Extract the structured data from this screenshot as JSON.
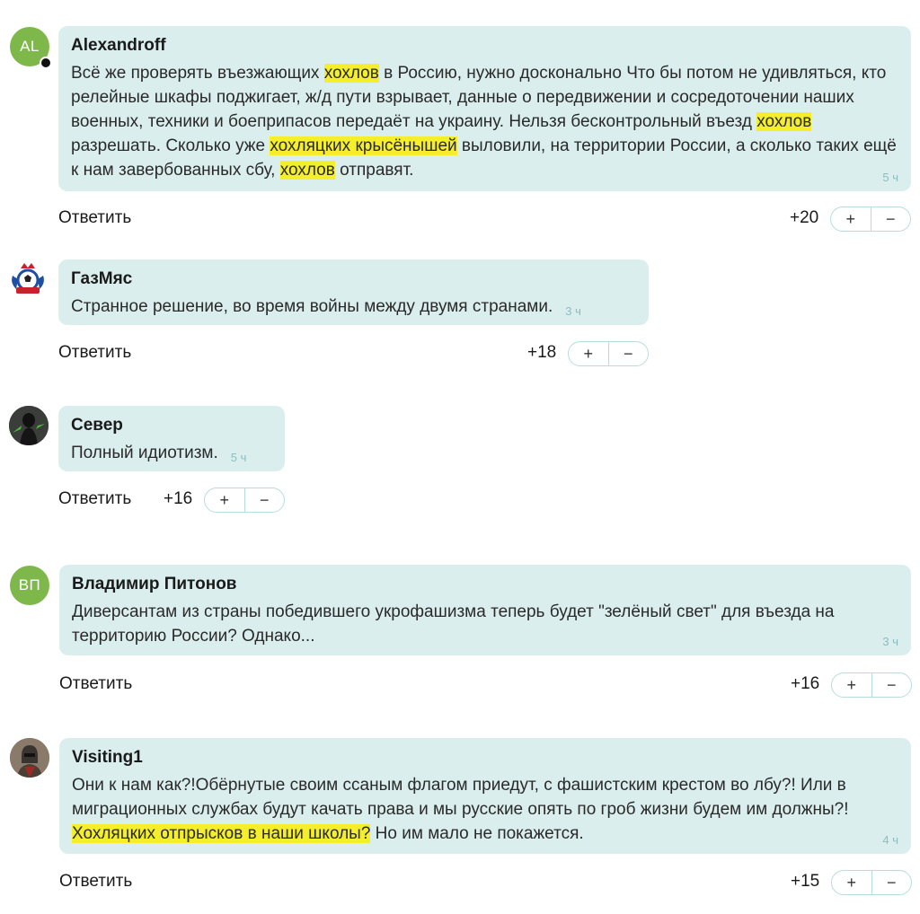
{
  "comments": [
    {
      "author": "Alexandroff",
      "avatar_initials": "AL",
      "text_parts": [
        "Всё же проверять въезжающих ",
        "хохлов",
        " в Россию, нужно досконально Что бы потом не удивляться, кто релейные шкафы поджигает, ж/д пути взрывает, данные о передвижении и сосредоточении наших военных, техники и боеприпасов передаёт на украину. Нельзя бесконтрольный въезд ",
        "хохлов",
        " разрешать. Сколько уже ",
        "хохляцких крысёнышей",
        " выловили, на территории России, а сколько таких ещё к нам завербованных сбу, ",
        "хохлов",
        " отправят."
      ],
      "time": "5 ч",
      "reply_label": "Ответить",
      "score": "+20",
      "vote_plus": "+",
      "vote_minus": "−"
    },
    {
      "author": "ГазМяс",
      "avatar_icon": "football-club-emblem-icon",
      "text": "Странное решение, во время войны между двумя странами.",
      "time": "3 ч",
      "reply_label": "Ответить",
      "score": "+18",
      "vote_plus": "+",
      "vote_minus": "−"
    },
    {
      "author": "Север",
      "avatar_icon": "dark-figure-photo-icon",
      "text": "Полный идиотизм.",
      "time": "5 ч",
      "reply_label": "Ответить",
      "score": "+16",
      "vote_plus": "+",
      "vote_minus": "−"
    },
    {
      "author": "Владимир Питонов",
      "avatar_initials": "ВП",
      "text": "Диверсантам из страны победившего укрофашизма теперь будет \"зелёный свет\" для въезда на территорию России? Однако...",
      "time": "3 ч",
      "reply_label": "Ответить",
      "score": "+16",
      "vote_plus": "+",
      "vote_minus": "−"
    },
    {
      "author": "Visiting1",
      "avatar_icon": "helmeted-warrior-photo-icon",
      "text_parts": [
        "Они к нам как?!Обёрнутые своим ссаным флагом приедут, с фашистским крестом во лбу?! Или в миграционных службах будут качать права и мы русские опять по гроб жизни будем им должны?!",
        "Хохляцких отпрысков в наши школы?",
        " Но им мало не покажется."
      ],
      "time": "4 ч",
      "reply_label": "Ответить",
      "score": "+15",
      "vote_plus": "+",
      "vote_minus": "−"
    }
  ],
  "colors": {
    "bubble": "#dbeeee",
    "highlight": "#f4ef2a",
    "initials_avatar": "#7fb84a",
    "time": "#8cbcc0"
  }
}
